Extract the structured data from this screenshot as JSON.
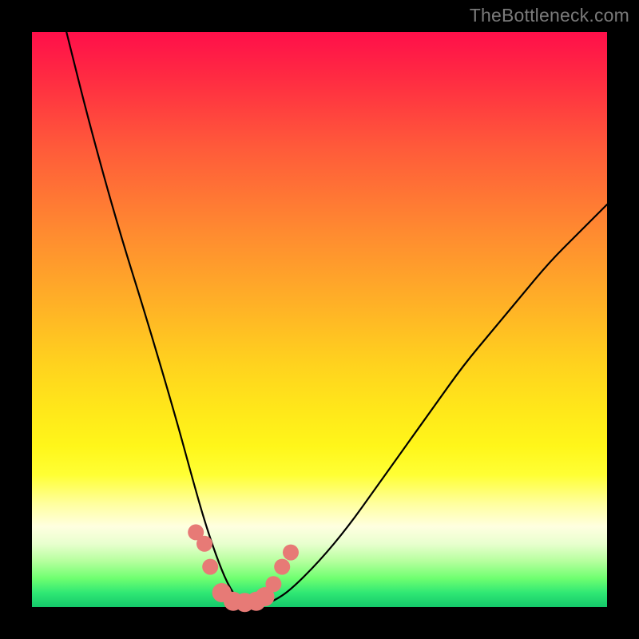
{
  "watermark": "TheBottleneck.com",
  "chart_data": {
    "type": "line",
    "title": "",
    "xlabel": "",
    "ylabel": "",
    "xlim": [
      0,
      100
    ],
    "ylim": [
      0,
      100
    ],
    "grid": false,
    "series": [
      {
        "name": "bottleneck-curve",
        "x": [
          6,
          10,
          15,
          20,
          25,
          28,
          30,
          32,
          34,
          36,
          38,
          40,
          42,
          45,
          50,
          55,
          60,
          65,
          70,
          75,
          80,
          85,
          90,
          95,
          100
        ],
        "values": [
          100,
          84,
          66,
          50,
          33,
          22,
          15,
          9,
          4,
          1,
          0.5,
          0.5,
          1,
          3,
          8,
          14,
          21,
          28,
          35,
          42,
          48,
          54,
          60,
          65,
          70
        ]
      }
    ],
    "markers": {
      "name": "highlight-points",
      "color": "#e77a76",
      "x": [
        28.5,
        30.0,
        31.0,
        33.0,
        35.0,
        37.0,
        39.0,
        40.5,
        42.0,
        43.5,
        45.0
      ],
      "values": [
        13.0,
        11.0,
        7.0,
        2.5,
        1.0,
        0.8,
        1.0,
        1.8,
        4.0,
        7.0,
        9.5
      ],
      "radius": [
        10,
        10,
        10,
        12,
        12,
        12,
        12,
        12,
        10,
        10,
        10
      ]
    },
    "gradient_stops": [
      {
        "pos": 0.0,
        "color": "#ff0f4a"
      },
      {
        "pos": 0.35,
        "color": "#ff8b30"
      },
      {
        "pos": 0.66,
        "color": "#ffe81a"
      },
      {
        "pos": 0.86,
        "color": "#ffffe0"
      },
      {
        "pos": 1.0,
        "color": "#14c96a"
      }
    ]
  }
}
